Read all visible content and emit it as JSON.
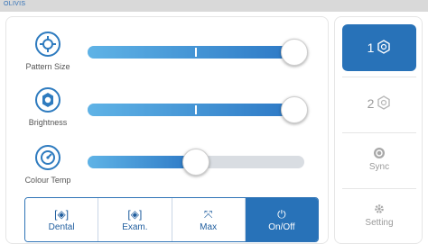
{
  "brand": {
    "text": "OLIVIS"
  },
  "controls": {
    "pattern_size": {
      "label": "Pattern Size",
      "value_percent": 96
    },
    "brightness": {
      "label": "Brightness",
      "value_percent": 96
    },
    "colour_temp": {
      "label": "Colour Temp",
      "value_percent": 50
    }
  },
  "modes": [
    {
      "label": "Dental",
      "glyph": "[◈]",
      "active": false
    },
    {
      "label": "Exam.",
      "glyph": "[◈]",
      "active": false
    },
    {
      "label": "Max",
      "glyph": "⤧",
      "active": false
    },
    {
      "label": "On/Off",
      "glyph": "⏻",
      "active": true
    }
  ],
  "side": {
    "light1": {
      "number": "1",
      "icon": "lamp-icon",
      "active": true
    },
    "light2": {
      "number": "2",
      "icon": "lamp-icon",
      "active": false
    },
    "sync": {
      "label": "Sync"
    },
    "setting": {
      "label": "Setting"
    }
  },
  "colors": {
    "accent": "#2872b8",
    "fill_start": "#5fb3e6",
    "track": "#d9dde2"
  }
}
